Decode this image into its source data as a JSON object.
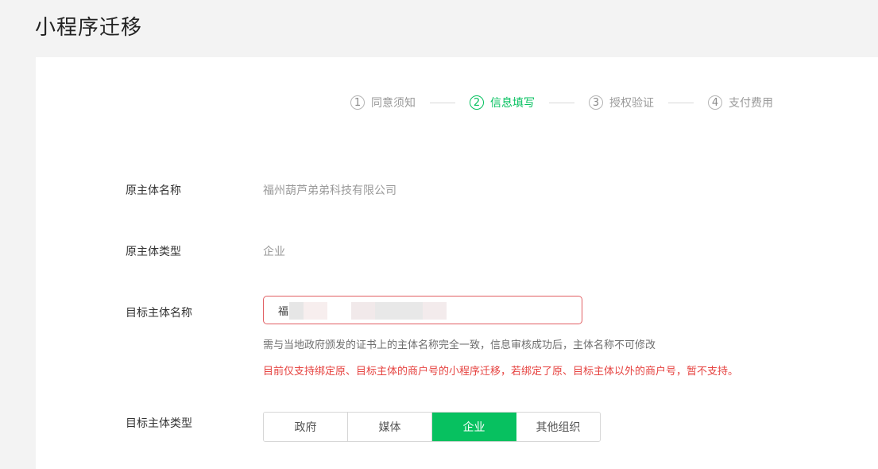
{
  "page": {
    "title": "小程序迁移"
  },
  "steps": [
    {
      "num": "1",
      "label": "同意须知",
      "active": false
    },
    {
      "num": "2",
      "label": "信息填写",
      "active": true
    },
    {
      "num": "3",
      "label": "授权验证",
      "active": false
    },
    {
      "num": "4",
      "label": "支付费用",
      "active": false
    }
  ],
  "form": {
    "original_name": {
      "label": "原主体名称",
      "value": "福州葫芦弟弟科技有限公司"
    },
    "original_type": {
      "label": "原主体类型",
      "value": "企业"
    },
    "target_name": {
      "label": "目标主体名称",
      "value": "福　　　　　　　　　司",
      "hint": "需与当地政府颁发的证书上的主体名称完全一致，信息审核成功后，主体名称不可修改",
      "warning": "目前仅支持绑定原、目标主体的商户号的小程序迁移，若绑定了原、目标主体以外的商户号，暂不支持。"
    },
    "target_type": {
      "label": "目标主体类型",
      "options": [
        "政府",
        "媒体",
        "企业",
        "其他组织"
      ],
      "selected": "企业"
    }
  },
  "colors": {
    "accent": "#07c160",
    "error": "#e64340",
    "input_border_error": "#e15f63"
  }
}
